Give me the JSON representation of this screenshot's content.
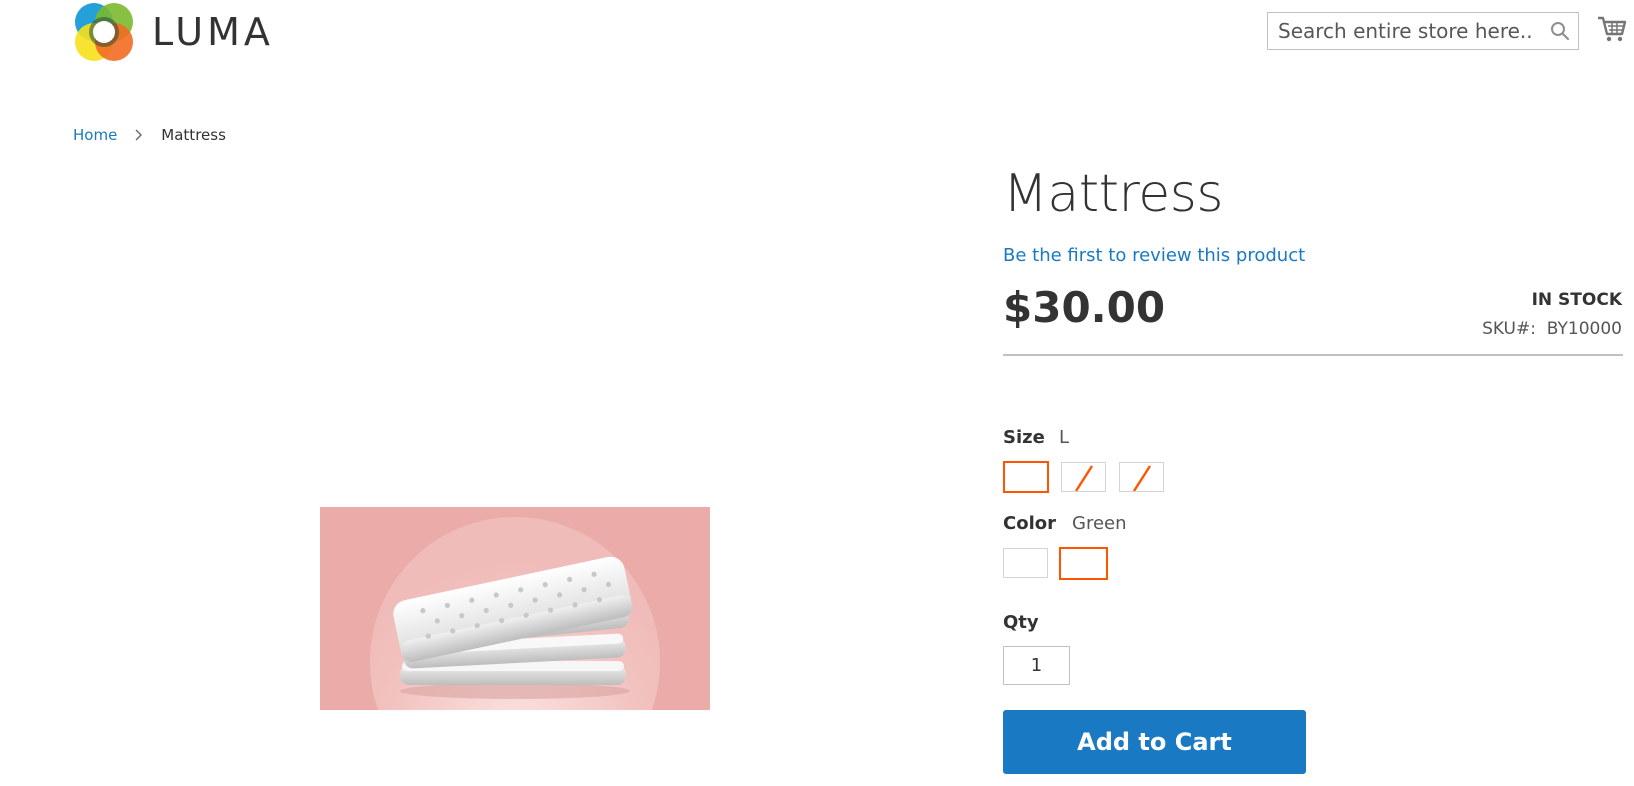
{
  "header": {
    "logo_text": "LUMA",
    "search": {
      "placeholder": "Search entire store here..."
    },
    "icons": [
      "luma-logo",
      "search-icon",
      "shopping-cart-icon"
    ]
  },
  "breadcrumb": {
    "home": "Home",
    "current": "Mattress"
  },
  "product": {
    "title": "Mattress",
    "review_link": "Be the first to review this product",
    "price": "$30.00",
    "stock": "IN STOCK",
    "sku_label": "SKU#:",
    "sku_value": "BY10000",
    "size": {
      "label": "Size",
      "selected_value": "L",
      "swatches": [
        {
          "state": "selected"
        },
        {
          "state": "disabled"
        },
        {
          "state": "disabled"
        }
      ]
    },
    "color": {
      "label": "Color",
      "selected_value": "Green",
      "swatches": [
        {
          "state": "normal"
        },
        {
          "state": "selected"
        }
      ]
    },
    "qty_label": "Qty",
    "qty_value": "1",
    "add_to_cart": "Add to Cart"
  },
  "colors": {
    "link": "#1979c3",
    "button": "#1979c3",
    "swatch_selected": "#ff5501",
    "image_background": "#ebaca9"
  }
}
